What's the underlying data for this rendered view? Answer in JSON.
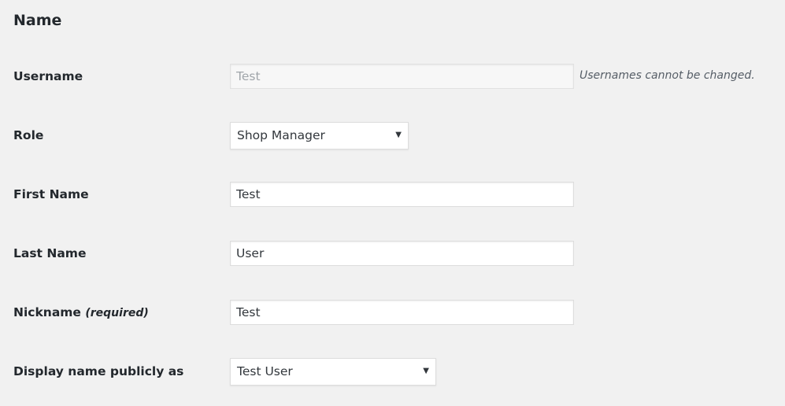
{
  "section": {
    "title": "Name"
  },
  "fields": {
    "username": {
      "label": "Username",
      "value": "Test",
      "description": "Usernames cannot be changed."
    },
    "role": {
      "label": "Role",
      "selected": "Shop Manager"
    },
    "first_name": {
      "label": "First Name",
      "value": "Test"
    },
    "last_name": {
      "label": "Last Name",
      "value": "User"
    },
    "nickname": {
      "label": "Nickname",
      "required_note": "(required)",
      "value": "Test"
    },
    "display_name": {
      "label": "Display name publicly as",
      "selected": "Test User"
    }
  },
  "icons": {
    "dropdown_arrow": "▼"
  },
  "colors": {
    "background": "#f1f1f1",
    "input_background": "#ffffff",
    "disabled_background": "#f7f7f7",
    "border": "#dddddd",
    "text": "#23282d",
    "muted_text": "#a0a5aa"
  }
}
